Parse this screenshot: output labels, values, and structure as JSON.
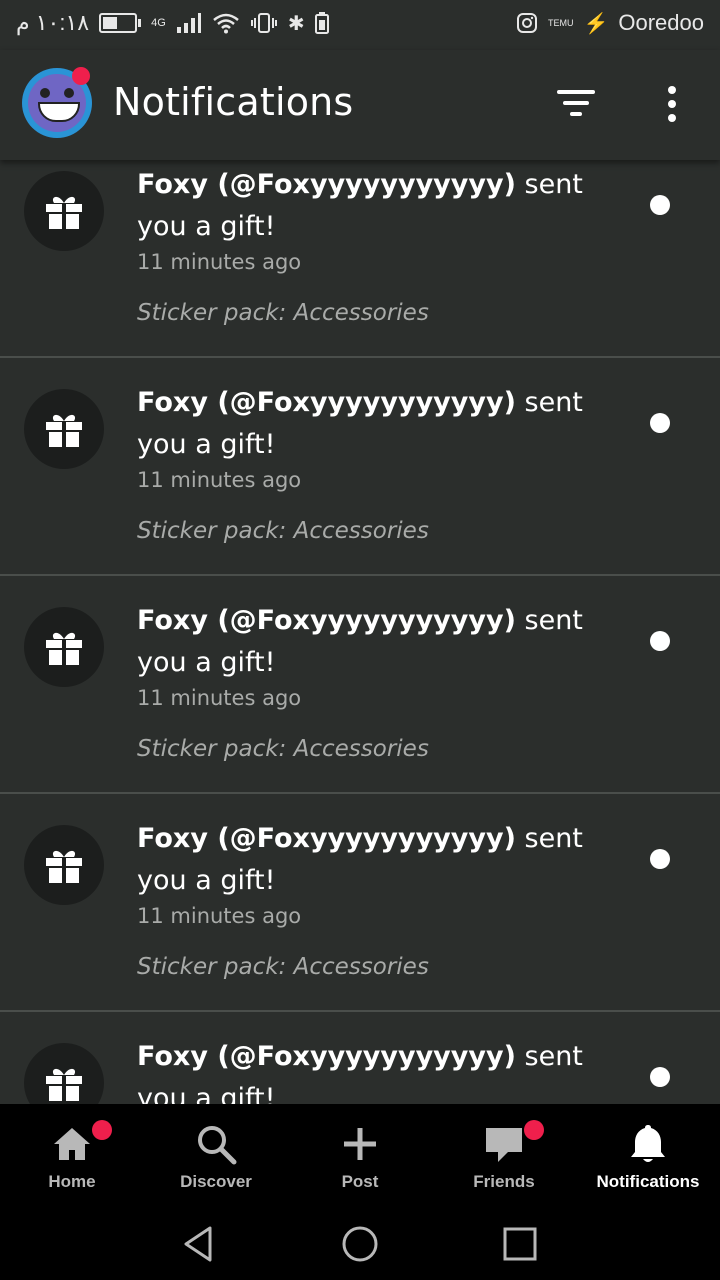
{
  "status_bar": {
    "time": "١٠:١٨ م",
    "network": "4G",
    "carrier": "Ooredoo",
    "temu_label": "TEMU"
  },
  "header": {
    "title": "Notifications"
  },
  "notifications": [
    {
      "sender": "Foxy (@Foxyyyyyyyyyyy)",
      "action": "sent you a gift!",
      "time": "11 minutes ago",
      "detail": "Sticker pack: Accessories",
      "icon": "gift-icon",
      "unread": true
    },
    {
      "sender": "Foxy (@Foxyyyyyyyyyyy)",
      "action": "sent you a gift!",
      "time": "11 minutes ago",
      "detail": "Sticker pack: Accessories",
      "icon": "gift-icon",
      "unread": true
    },
    {
      "sender": "Foxy (@Foxyyyyyyyyyyy)",
      "action": "sent you a gift!",
      "time": "11 minutes ago",
      "detail": "Sticker pack: Accessories",
      "icon": "gift-icon",
      "unread": true
    },
    {
      "sender": "Foxy (@Foxyyyyyyyyyyy)",
      "action": "sent you a gift!",
      "time": "11 minutes ago",
      "detail": "Sticker pack: Accessories",
      "icon": "gift-icon",
      "unread": true
    },
    {
      "sender": "Foxy (@Foxyyyyyyyyyyy)",
      "action": "sent you a gift!",
      "time": "",
      "detail": "",
      "icon": "gift-icon",
      "unread": true
    }
  ],
  "bottom_nav": {
    "home": "Home",
    "discover": "Discover",
    "post": "Post",
    "friends": "Friends",
    "notifications": "Notifications",
    "active": "notifications"
  },
  "colors": {
    "background": "#2b2e2c",
    "badge": "#ef1f4c",
    "nav_background": "#000000",
    "secondary_text": "#a9aba9"
  }
}
